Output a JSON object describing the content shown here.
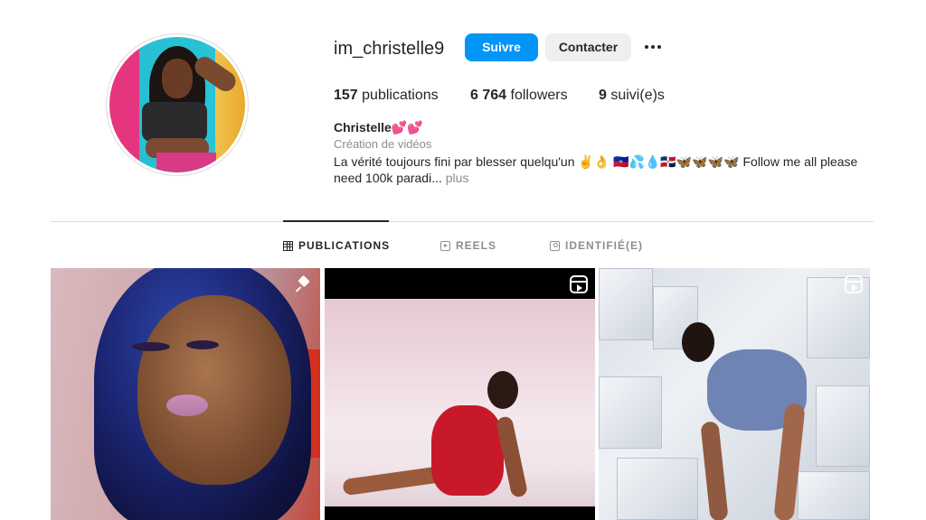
{
  "profile": {
    "username": "im_christelle9",
    "follow_label": "Suivre",
    "contact_label": "Contacter",
    "stats": {
      "posts_count": "157",
      "posts_label": " publications",
      "followers_count": "6 764",
      "followers_label": " followers",
      "following_count": "9",
      "following_label": " suivi(e)s"
    },
    "bio": {
      "name": "Christelle💕💕",
      "category": "Création de vidéos",
      "text": "La vérité toujours fini par blesser quelqu'un ✌️👌 🇭🇹💦💧🇩🇴🦋🦋🦋🦋 Follow me all please need 100k paradi...",
      "more_label": " plus"
    }
  },
  "tabs": [
    {
      "label": "PUBLICATIONS",
      "icon": "grid-icon",
      "active": true
    },
    {
      "label": "REELS",
      "icon": "reels-icon",
      "active": false
    },
    {
      "label": "IDENTIFIÉ(E)",
      "icon": "tagged-icon",
      "active": false
    }
  ],
  "posts": [
    {
      "overlay_icon": "pin-icon"
    },
    {
      "overlay_icon": "reel-icon"
    },
    {
      "overlay_icon": "reel-icon"
    }
  ],
  "colors": {
    "accent": "#0095f6",
    "secondary_button": "#efefef",
    "text": "#262626",
    "muted": "#8e8e8e"
  }
}
